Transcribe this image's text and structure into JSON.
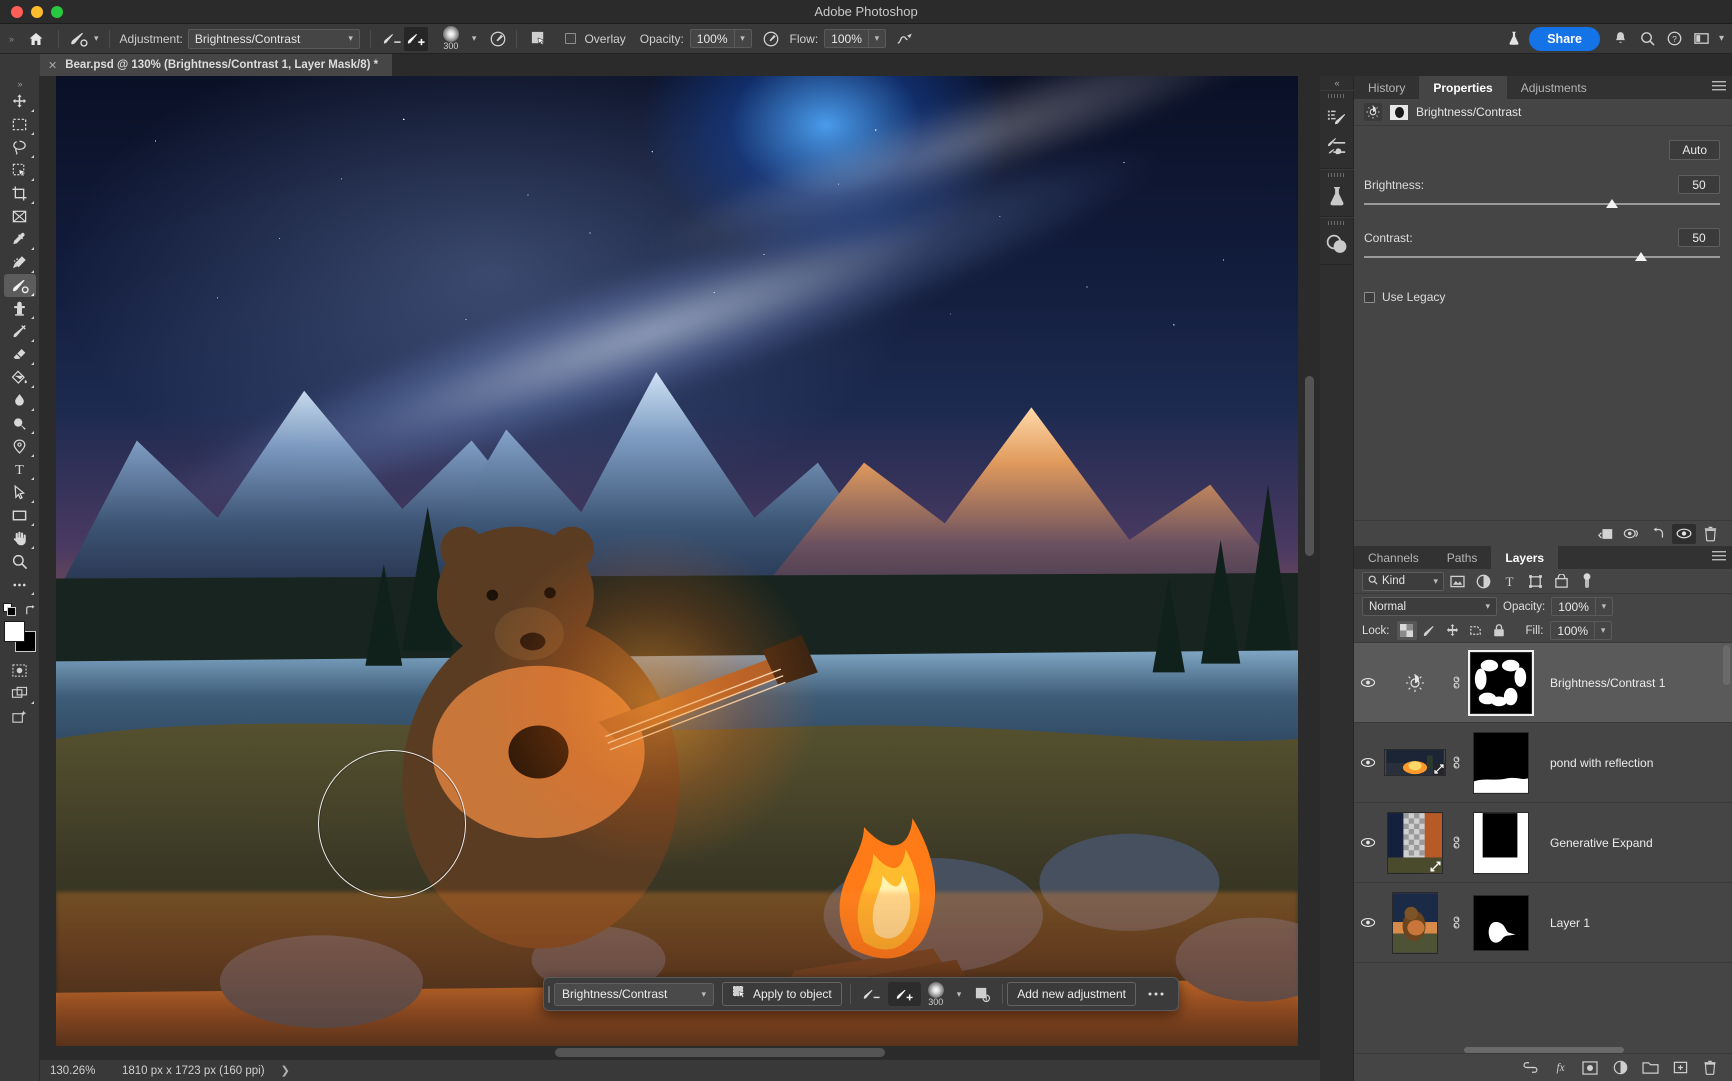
{
  "window": {
    "title": "Adobe Photoshop"
  },
  "options_bar": {
    "home_icon": "home-icon",
    "tool_preset_icon": "brush-tool-icon",
    "adjustment_label": "Adjustment:",
    "adjustment_value": "Brightness/Contrast",
    "subtract_icon": "brush-minus-icon",
    "add_icon": "brush-plus-icon",
    "brush_size": "300",
    "brush_settings_icon": "brush-settings-icon",
    "selection_icon": "selection-mask-icon",
    "overlay_label": "Overlay",
    "overlay_checked": false,
    "opacity_label": "Opacity:",
    "opacity_value": "100%",
    "airbrush_icon": "airbrush-icon",
    "flow_label": "Flow:",
    "flow_value": "100%",
    "smoothing_icon": "brush-smoothing-icon",
    "lab_icon": "beaker-icon",
    "share_label": "Share",
    "bell_icon": "bell-icon",
    "search_icon": "search-icon",
    "help_icon": "help-icon",
    "workspace_icon": "workspace-icon",
    "chevron_icon": "chevron-down-icon"
  },
  "document_tab": {
    "close_icon": "close-icon",
    "title": "Bear.psd @ 130% (Brightness/Contrast 1, Layer Mask/8) *"
  },
  "toolbar": {
    "tools": [
      {
        "name": "move-tool",
        "icon": "move-icon",
        "selected": false
      },
      {
        "name": "rectangular-marquee-tool",
        "icon": "marquee-icon",
        "selected": false
      },
      {
        "name": "lasso-tool",
        "icon": "lasso-icon",
        "selected": false
      },
      {
        "name": "object-selection-tool",
        "icon": "object-select-icon",
        "selected": false
      },
      {
        "name": "crop-tool",
        "icon": "crop-icon",
        "selected": false
      },
      {
        "name": "frame-tool",
        "icon": "frame-icon",
        "selected": false
      },
      {
        "name": "eyedropper-tool",
        "icon": "eyedropper-icon",
        "selected": false
      },
      {
        "name": "spot-healing-brush-tool",
        "icon": "healing-brush-icon",
        "selected": false
      },
      {
        "name": "brush-tool",
        "icon": "brush-icon",
        "selected": true
      },
      {
        "name": "clone-stamp-tool",
        "icon": "stamp-icon",
        "selected": false
      },
      {
        "name": "history-brush-tool",
        "icon": "history-brush-icon",
        "selected": false
      },
      {
        "name": "eraser-tool",
        "icon": "eraser-icon",
        "selected": false
      },
      {
        "name": "gradient-tool",
        "icon": "paint-bucket-icon",
        "selected": false
      },
      {
        "name": "blur-tool",
        "icon": "blur-drop-icon",
        "selected": false
      },
      {
        "name": "dodge-tool",
        "icon": "dodge-icon",
        "selected": false
      },
      {
        "name": "pen-tool",
        "icon": "pen-icon",
        "selected": false
      },
      {
        "name": "type-tool",
        "icon": "type-icon",
        "selected": false
      },
      {
        "name": "path-selection-tool",
        "icon": "path-arrow-icon",
        "selected": false
      },
      {
        "name": "rectangle-tool",
        "icon": "rectangle-icon",
        "selected": false
      },
      {
        "name": "hand-tool",
        "icon": "hand-icon",
        "selected": false
      },
      {
        "name": "zoom-tool",
        "icon": "magnifier-icon",
        "selected": false
      },
      {
        "name": "edit-toolbar",
        "icon": "ellipsis-icon",
        "selected": false
      }
    ],
    "default_colors_icon": "default-colors-icon",
    "swap_colors_icon": "swap-colors-icon",
    "foreground_color": "#ffffff",
    "background_color": "#000000",
    "quick_mask_icon": "quick-mask-icon",
    "screen_mode_icon": "screen-mode-icon",
    "generative_fill_icon": "generative-fill-icon"
  },
  "canvas": {
    "brush_cursor": "brush-cursor-circle"
  },
  "contextual_taskbar": {
    "adjustment_value": "Brightness/Contrast",
    "apply_icon": "apply-to-object-icon",
    "apply_label": "Apply to object",
    "subtract_icon": "brush-minus-icon",
    "add_icon": "brush-plus-icon",
    "brush_size": "300",
    "mask_icon": "mask-settings-icon",
    "add_adjustment_label": "Add new adjustment",
    "more_icon": "ellipsis-icon"
  },
  "status_bar": {
    "zoom": "130.26%",
    "dimensions": "1810 px x 1723 px (160 ppi)",
    "expand_icon": "chevron-right-icon"
  },
  "right_rail": {
    "collapse_icon": "double-chevron-left-icon",
    "icons": [
      {
        "name": "brush-settings-rail-icon"
      },
      {
        "name": "brush-presets-rail-icon"
      },
      {
        "name": "beaker-rail-icon"
      },
      {
        "name": "blend-modes-rail-icon"
      }
    ]
  },
  "properties_panel": {
    "tabs": [
      {
        "label": "History",
        "active": false
      },
      {
        "label": "Properties",
        "active": true
      },
      {
        "label": "Adjustments",
        "active": false
      }
    ],
    "menu_icon": "panel-menu-icon",
    "header_icon": "brightness-contrast-icon",
    "mask_icon": "layer-mask-icon",
    "header_title": "Brightness/Contrast",
    "auto_label": "Auto",
    "brightness_label": "Brightness:",
    "brightness_value": "50",
    "contrast_label": "Contrast:",
    "contrast_value": "50",
    "use_legacy_label": "Use Legacy",
    "use_legacy_checked": false,
    "footer_icons": [
      {
        "name": "clip-to-layer-icon",
        "active": false
      },
      {
        "name": "view-previous-state-icon",
        "active": false
      },
      {
        "name": "reset-icon",
        "active": false
      },
      {
        "name": "toggle-visibility-icon",
        "active": true
      },
      {
        "name": "delete-icon",
        "active": false
      }
    ]
  },
  "layers_panel": {
    "tabs": [
      {
        "label": "Channels",
        "active": false
      },
      {
        "label": "Paths",
        "active": false
      },
      {
        "label": "Layers",
        "active": true
      }
    ],
    "menu_icon": "panel-menu-icon",
    "filter_kind_label": "Kind",
    "filter_search_icon": "search-icon",
    "filter_icons": [
      {
        "name": "filter-pixel-icon"
      },
      {
        "name": "filter-adjustment-icon"
      },
      {
        "name": "filter-type-icon"
      },
      {
        "name": "filter-shape-icon"
      },
      {
        "name": "filter-smart-object-icon"
      }
    ],
    "filter_toggle_icon": "filter-toggle-icon",
    "blend_mode": "Normal",
    "opacity_label": "Opacity:",
    "opacity_value": "100%",
    "lock_label": "Lock:",
    "lock_icons": [
      {
        "name": "lock-transparent-pixels-icon",
        "active": true
      },
      {
        "name": "lock-image-pixels-icon",
        "active": false
      },
      {
        "name": "lock-position-icon",
        "active": false
      },
      {
        "name": "lock-artboard-nesting-icon",
        "active": false
      },
      {
        "name": "lock-all-icon",
        "active": false
      }
    ],
    "fill_label": "Fill:",
    "fill_value": "100%",
    "layers": [
      {
        "name": "Brightness/Contrast 1",
        "visible": true,
        "selected": true,
        "thumb_type": "adjustment",
        "mask_selected": true
      },
      {
        "name": "pond with reflection",
        "visible": true,
        "selected": false,
        "thumb_type": "image-fire",
        "mask_selected": false
      },
      {
        "name": "Generative Expand",
        "visible": true,
        "selected": false,
        "thumb_type": "image-expand",
        "mask_selected": false
      },
      {
        "name": "Layer 1",
        "visible": true,
        "selected": false,
        "thumb_type": "image-bear",
        "mask_selected": false
      }
    ],
    "footer_icons": [
      {
        "name": "link-layers-icon"
      },
      {
        "name": "layer-style-icon"
      },
      {
        "name": "add-layer-mask-icon"
      },
      {
        "name": "new-adjustment-layer-icon"
      },
      {
        "name": "new-group-icon"
      },
      {
        "name": "new-layer-icon"
      },
      {
        "name": "delete-layer-icon"
      }
    ]
  },
  "colors": {
    "accent": "#1473e6",
    "panel_bg": "#454545",
    "chrome_bg": "#393939",
    "selected_row": "#5a5a5a"
  }
}
